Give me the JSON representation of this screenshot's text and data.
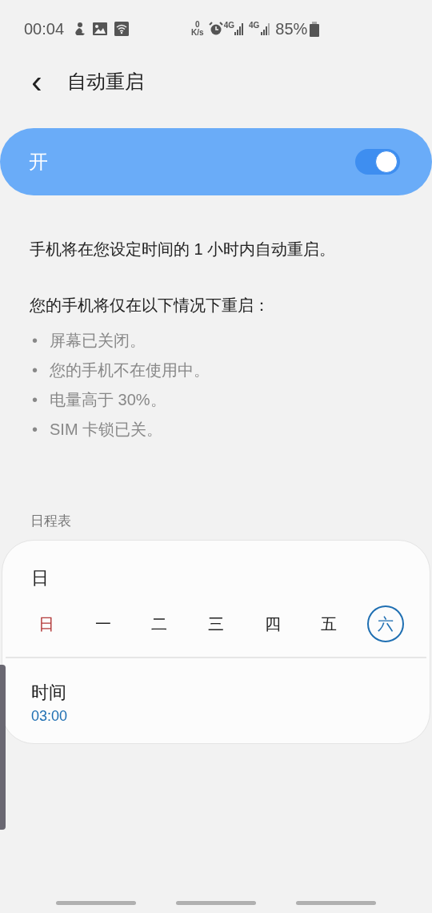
{
  "status_bar": {
    "time": "00:04",
    "net_speed_value": "0",
    "net_speed_unit": "K/s",
    "network_1": "4G",
    "network_2": "4G",
    "battery": "85%"
  },
  "header": {
    "back": "‹",
    "title": "自动重启"
  },
  "master_switch": {
    "label": "开",
    "on": true
  },
  "description": "手机将在您设定时间的 1 小时内自动重启。",
  "conditions": {
    "heading": "您的手机将仅在以下情况下重启：",
    "items": [
      {
        "bullet": "•",
        "text": "屏幕已关闭。"
      },
      {
        "bullet": "•",
        "text": "您的手机不在使用中。"
      },
      {
        "bullet": "•",
        "text": "电量高于 30%。"
      },
      {
        "bullet": "•",
        "text": "SIM 卡锁已关。"
      }
    ]
  },
  "schedule": {
    "section_label": "日程表",
    "days_summary": "日",
    "days": [
      {
        "label": "日",
        "kind": "sunday",
        "selected": false
      },
      {
        "label": "一",
        "kind": "weekday",
        "selected": false
      },
      {
        "label": "二",
        "kind": "weekday",
        "selected": false
      },
      {
        "label": "三",
        "kind": "weekday",
        "selected": false
      },
      {
        "label": "四",
        "kind": "weekday",
        "selected": false
      },
      {
        "label": "五",
        "kind": "weekday",
        "selected": false
      },
      {
        "label": "六",
        "kind": "weekday",
        "selected": true
      }
    ],
    "time_label": "时间",
    "time_value": "03:00"
  }
}
